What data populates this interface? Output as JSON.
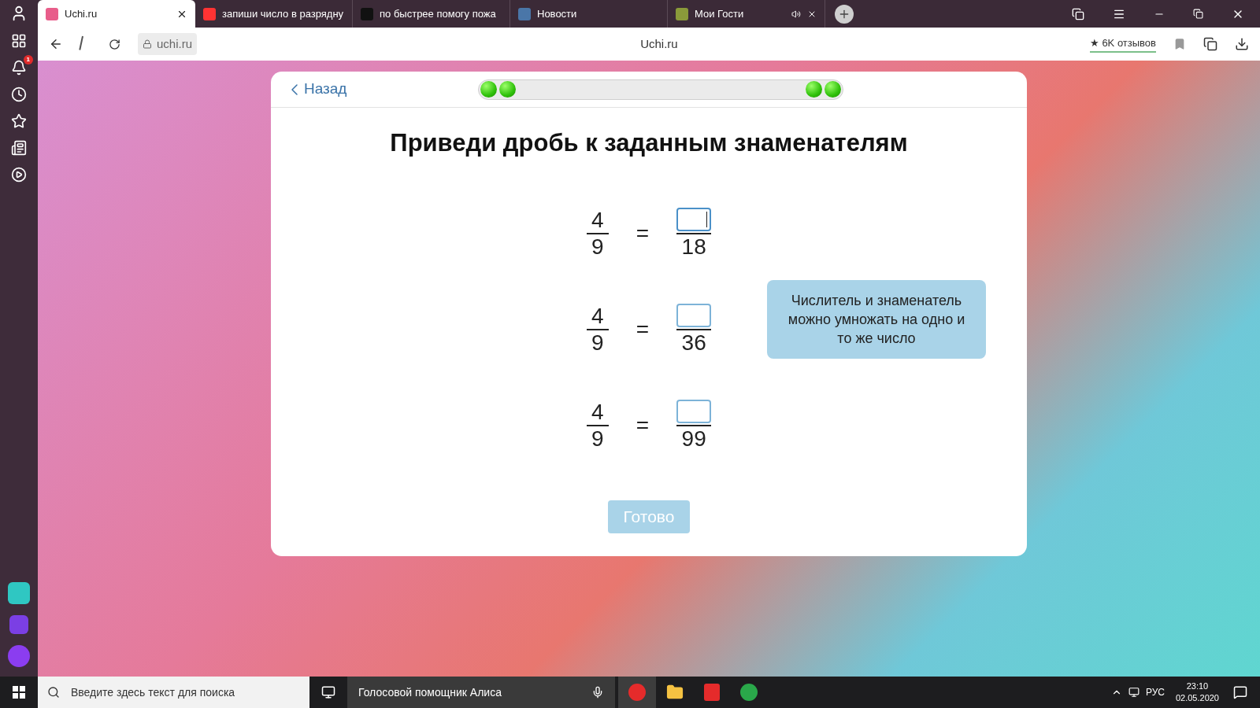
{
  "browser": {
    "tabs": [
      {
        "title": "Uchi.ru",
        "selected": true,
        "kind": "uchi"
      },
      {
        "title": "запиши число в разрядну",
        "selected": false,
        "kind": "yandex"
      },
      {
        "title": "по быстрее помогу пожа",
        "selected": false,
        "kind": "znanija"
      },
      {
        "title": "Новости",
        "selected": false,
        "kind": "vk"
      },
      {
        "title": "Мои Гости",
        "selected": false,
        "kind": "game"
      }
    ],
    "address": "uchi.ru",
    "page_title": "Uchi.ru",
    "reviews": "★ 6K отзывов",
    "notification_count": "1"
  },
  "lesson": {
    "back": "Назад",
    "progress_dots": [
      {
        "filled": true
      },
      {
        "filled": true
      },
      {
        "filled": true
      },
      {
        "filled": true
      }
    ],
    "title": "Приведи дробь к заданным знаменателям",
    "equations": [
      {
        "numerator": "4",
        "denominator": "9",
        "equals": "=",
        "target_denominator": "18",
        "focused": true
      },
      {
        "numerator": "4",
        "denominator": "9",
        "equals": "=",
        "target_denominator": "36",
        "focused": false
      },
      {
        "numerator": "4",
        "denominator": "9",
        "equals": "=",
        "target_denominator": "99",
        "focused": false
      }
    ],
    "hint": "Числитель и знаменатель можно умножать на одно и то же число",
    "submit": {
      "label": "Готово",
      "disabled": true
    }
  },
  "taskbar": {
    "search_placeholder": "Введите здесь текст для поиска",
    "assistant": "Голосовой помощник Алиса",
    "language": "РУС",
    "time": "23:10",
    "date": "02.05.2020"
  }
}
